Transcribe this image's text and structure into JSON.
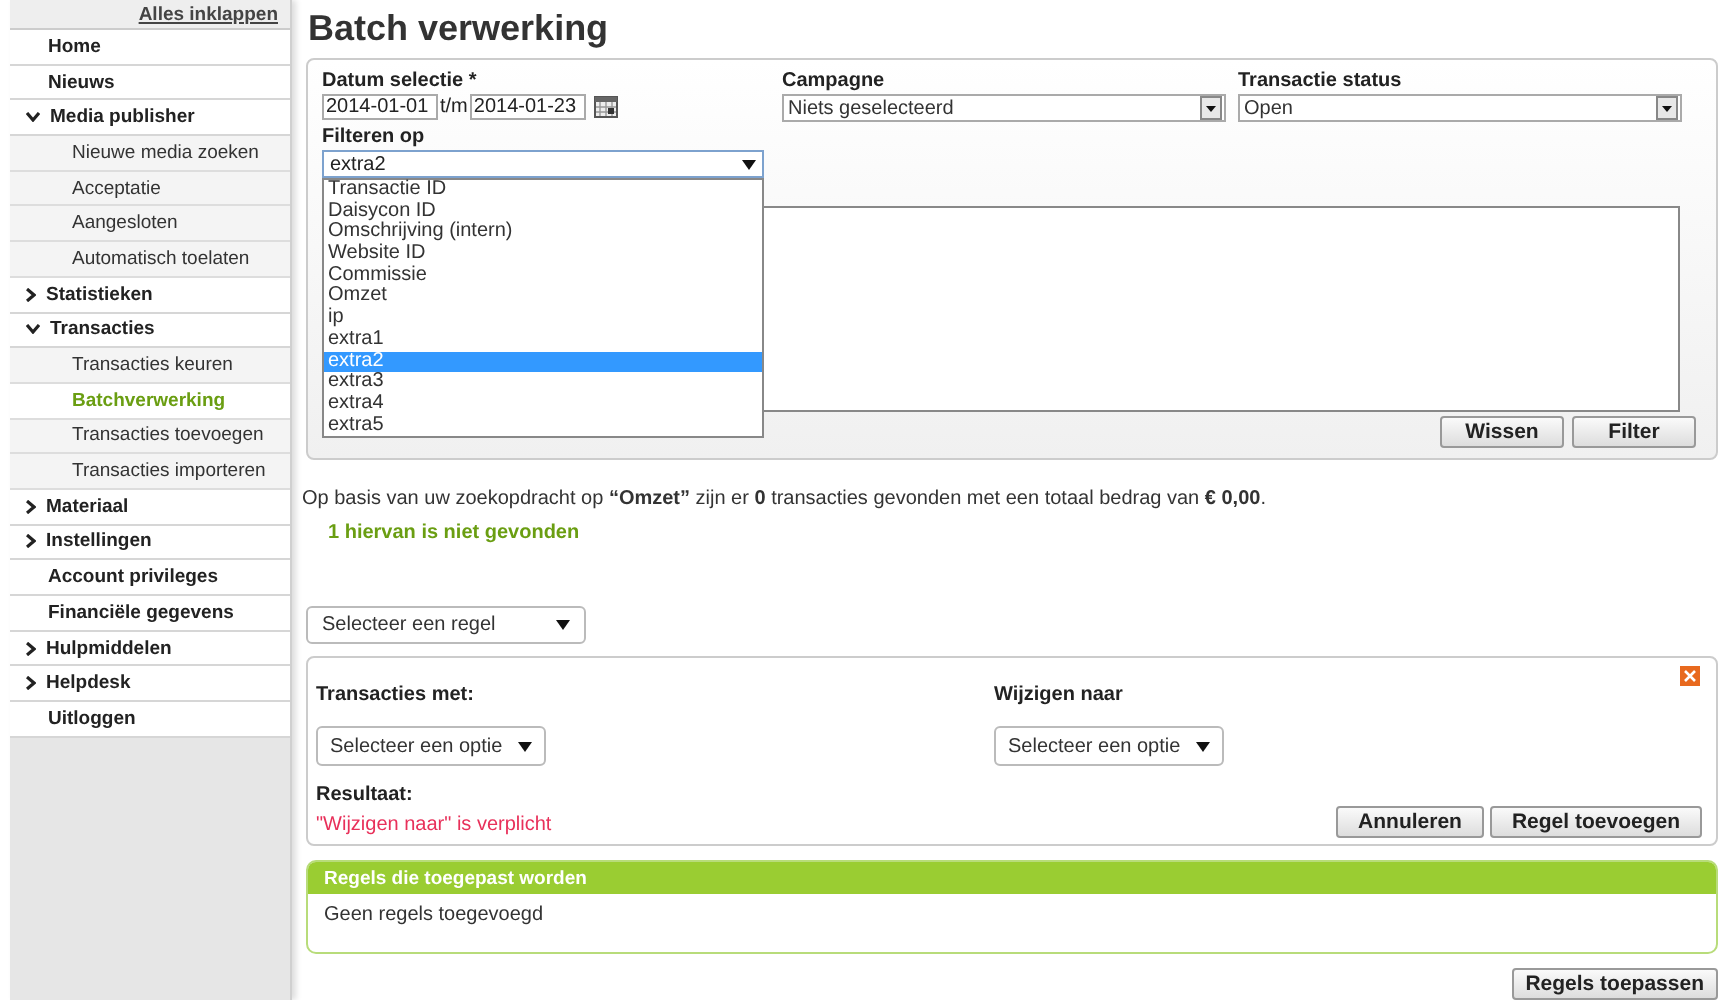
{
  "sidebar": {
    "collapse_link": "Alles inklappen",
    "items": [
      {
        "label": "Home",
        "kind": "link",
        "selected": false
      },
      {
        "label": "Nieuws",
        "kind": "link",
        "selected": false
      },
      {
        "label": "Media publisher",
        "kind": "group",
        "selected": false,
        "expanded": true,
        "children": [
          {
            "label": "Nieuwe media zoeken",
            "selected": false
          },
          {
            "label": "Acceptatie",
            "selected": false
          },
          {
            "label": "Aangesloten",
            "selected": false
          },
          {
            "label": "Automatisch toelaten",
            "selected": false
          }
        ]
      },
      {
        "label": "Statistieken",
        "kind": "group",
        "selected": false,
        "expanded": false
      },
      {
        "label": "Transacties",
        "kind": "group",
        "selected": false,
        "expanded": true,
        "children": [
          {
            "label": "Transacties keuren",
            "selected": false
          },
          {
            "label": "Batchverwerking",
            "selected": true
          },
          {
            "label": "Transacties toevoegen",
            "selected": false
          },
          {
            "label": "Transacties importeren",
            "selected": false
          }
        ]
      },
      {
        "label": "Materiaal",
        "kind": "group",
        "selected": false,
        "expanded": false
      },
      {
        "label": "Instellingen",
        "kind": "group",
        "selected": false,
        "expanded": false
      },
      {
        "label": "Account privileges",
        "kind": "link",
        "selected": false
      },
      {
        "label": "Financiële gegevens",
        "kind": "link",
        "selected": false
      },
      {
        "label": "Hulpmiddelen",
        "kind": "group",
        "selected": false,
        "expanded": false
      },
      {
        "label": "Helpdesk",
        "kind": "group",
        "selected": false,
        "expanded": false
      },
      {
        "label": "Uitloggen",
        "kind": "link",
        "selected": false
      }
    ]
  },
  "page_title": "Batch verwerking",
  "filter_panel": {
    "date_label": "Datum selectie *",
    "date_from": "2014-01-01",
    "date_separator": "t/m",
    "date_to": "2014-01-23",
    "campaign": {
      "label": "Campagne",
      "value": "Niets geselecteerd"
    },
    "status": {
      "label": "Transactie status",
      "value": "Open"
    },
    "filter_on": {
      "label": "Filteren op",
      "value": "extra2",
      "expanded": true,
      "options": [
        {
          "label": "Transactie ID",
          "selected": false
        },
        {
          "label": "Daisycon ID",
          "selected": false
        },
        {
          "label": "Omschrijving (intern)",
          "selected": false
        },
        {
          "label": "Website ID",
          "selected": false
        },
        {
          "label": "Commissie",
          "selected": false
        },
        {
          "label": "Omzet",
          "selected": false
        },
        {
          "label": "ip",
          "selected": false
        },
        {
          "label": "extra1",
          "selected": false
        },
        {
          "label": "extra2",
          "selected": true
        },
        {
          "label": "extra3",
          "selected": false
        },
        {
          "label": "extra4",
          "selected": false
        },
        {
          "label": "extra5",
          "selected": false
        }
      ]
    },
    "buttons": [
      "Wissen",
      "Filter"
    ]
  },
  "summary": "Op basis van uw zoekopdracht op **“Omzet”** zijn er **0** transacties gevonden met een totaal bedrag van **€ 0,00**.",
  "not_found": "1 hiervan is niet gevonden",
  "rule_select": "Selecteer een regel",
  "rule_panel": {
    "transactions_label": "Transacties met:",
    "transactions_select": "Selecteer een optie",
    "change_label": "Wijzigen naar",
    "change_select": "Selecteer een optie",
    "result_label": "Resultaat:",
    "error": "\"Wijzigen naar\" is verplicht",
    "buttons": [
      "Annuleren",
      "Regel toevoegen"
    ]
  },
  "applied_panel": {
    "title": "Regels die toegepast worden",
    "empty_text": "Geen regels toegevoegd"
  },
  "apply_button": "Regels toepassen"
}
